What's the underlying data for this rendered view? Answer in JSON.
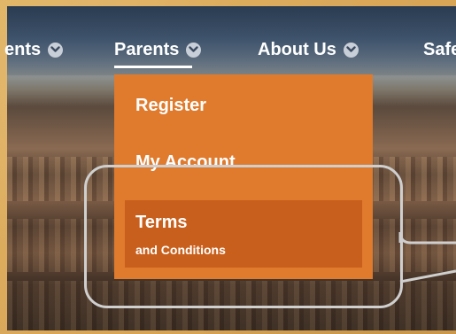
{
  "nav": {
    "items": [
      {
        "label": "ents"
      },
      {
        "label": "Parents"
      },
      {
        "label": "About Us"
      },
      {
        "label": "Safe"
      }
    ]
  },
  "dropdown": {
    "register": "Register",
    "my_account": "My Account",
    "terms": {
      "title": "Terms",
      "subtitle": "and Conditions"
    }
  },
  "colors": {
    "dropdown_bg": "#e07a2d",
    "dropdown_highlight": "#c95f1c",
    "frame": "#d9a658",
    "callout": "#cfcfcf"
  },
  "icons": {
    "nav_chevron": "chevron-down-icon"
  }
}
